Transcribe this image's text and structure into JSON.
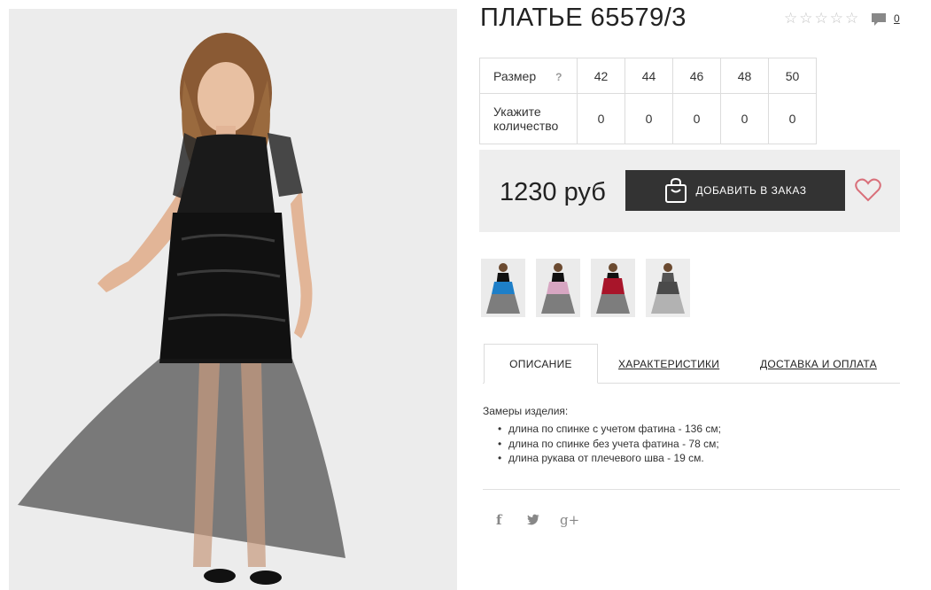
{
  "product": {
    "title": "ПЛАТЬЕ 65579/3",
    "rating_stars": 5,
    "comment_count": "0"
  },
  "icons": {
    "rating": "star-outline-icon",
    "comments": "speech-bubble-icon",
    "size_help": "question-mark-icon",
    "cart": "shopping-bag-icon",
    "wishlist": "heart-outline-icon",
    "facebook": "facebook-icon",
    "twitter": "twitter-icon",
    "google_plus": "google-plus-icon"
  },
  "size_table": {
    "size_label": "Размер",
    "help_mark": "?",
    "quantity_label": "Укажите количество",
    "sizes": [
      "42",
      "44",
      "46",
      "48",
      "50"
    ],
    "quantities": [
      "0",
      "0",
      "0",
      "0",
      "0"
    ]
  },
  "purchase": {
    "price": "1230 руб",
    "add_button_label": "ДОБАВИТЬ В ЗАКАЗ"
  },
  "colors": {
    "button_bg": "#333333",
    "panel_bg": "#eeeeee",
    "heart": "#d9707a",
    "thumb_variants": [
      "#1e7fc8",
      "#d7a6c2",
      "#a8152a",
      "#4a4a4a"
    ]
  },
  "tabs": {
    "description": "ОПИСАНИЕ",
    "characteristics": "ХАРАКТЕРИСТИКИ",
    "delivery": "ДОСТАВКА И ОПЛАТА"
  },
  "description": {
    "title": "Замеры изделия:",
    "items": [
      "длина по спинке с учетом фатина - 136 см;",
      "длина по спинке без учета фатина - 78 см;",
      "длина рукава от плечевого шва - 19 см."
    ]
  },
  "social": {
    "facebook": "f",
    "twitter": "🐦",
    "google_plus": "g+"
  }
}
